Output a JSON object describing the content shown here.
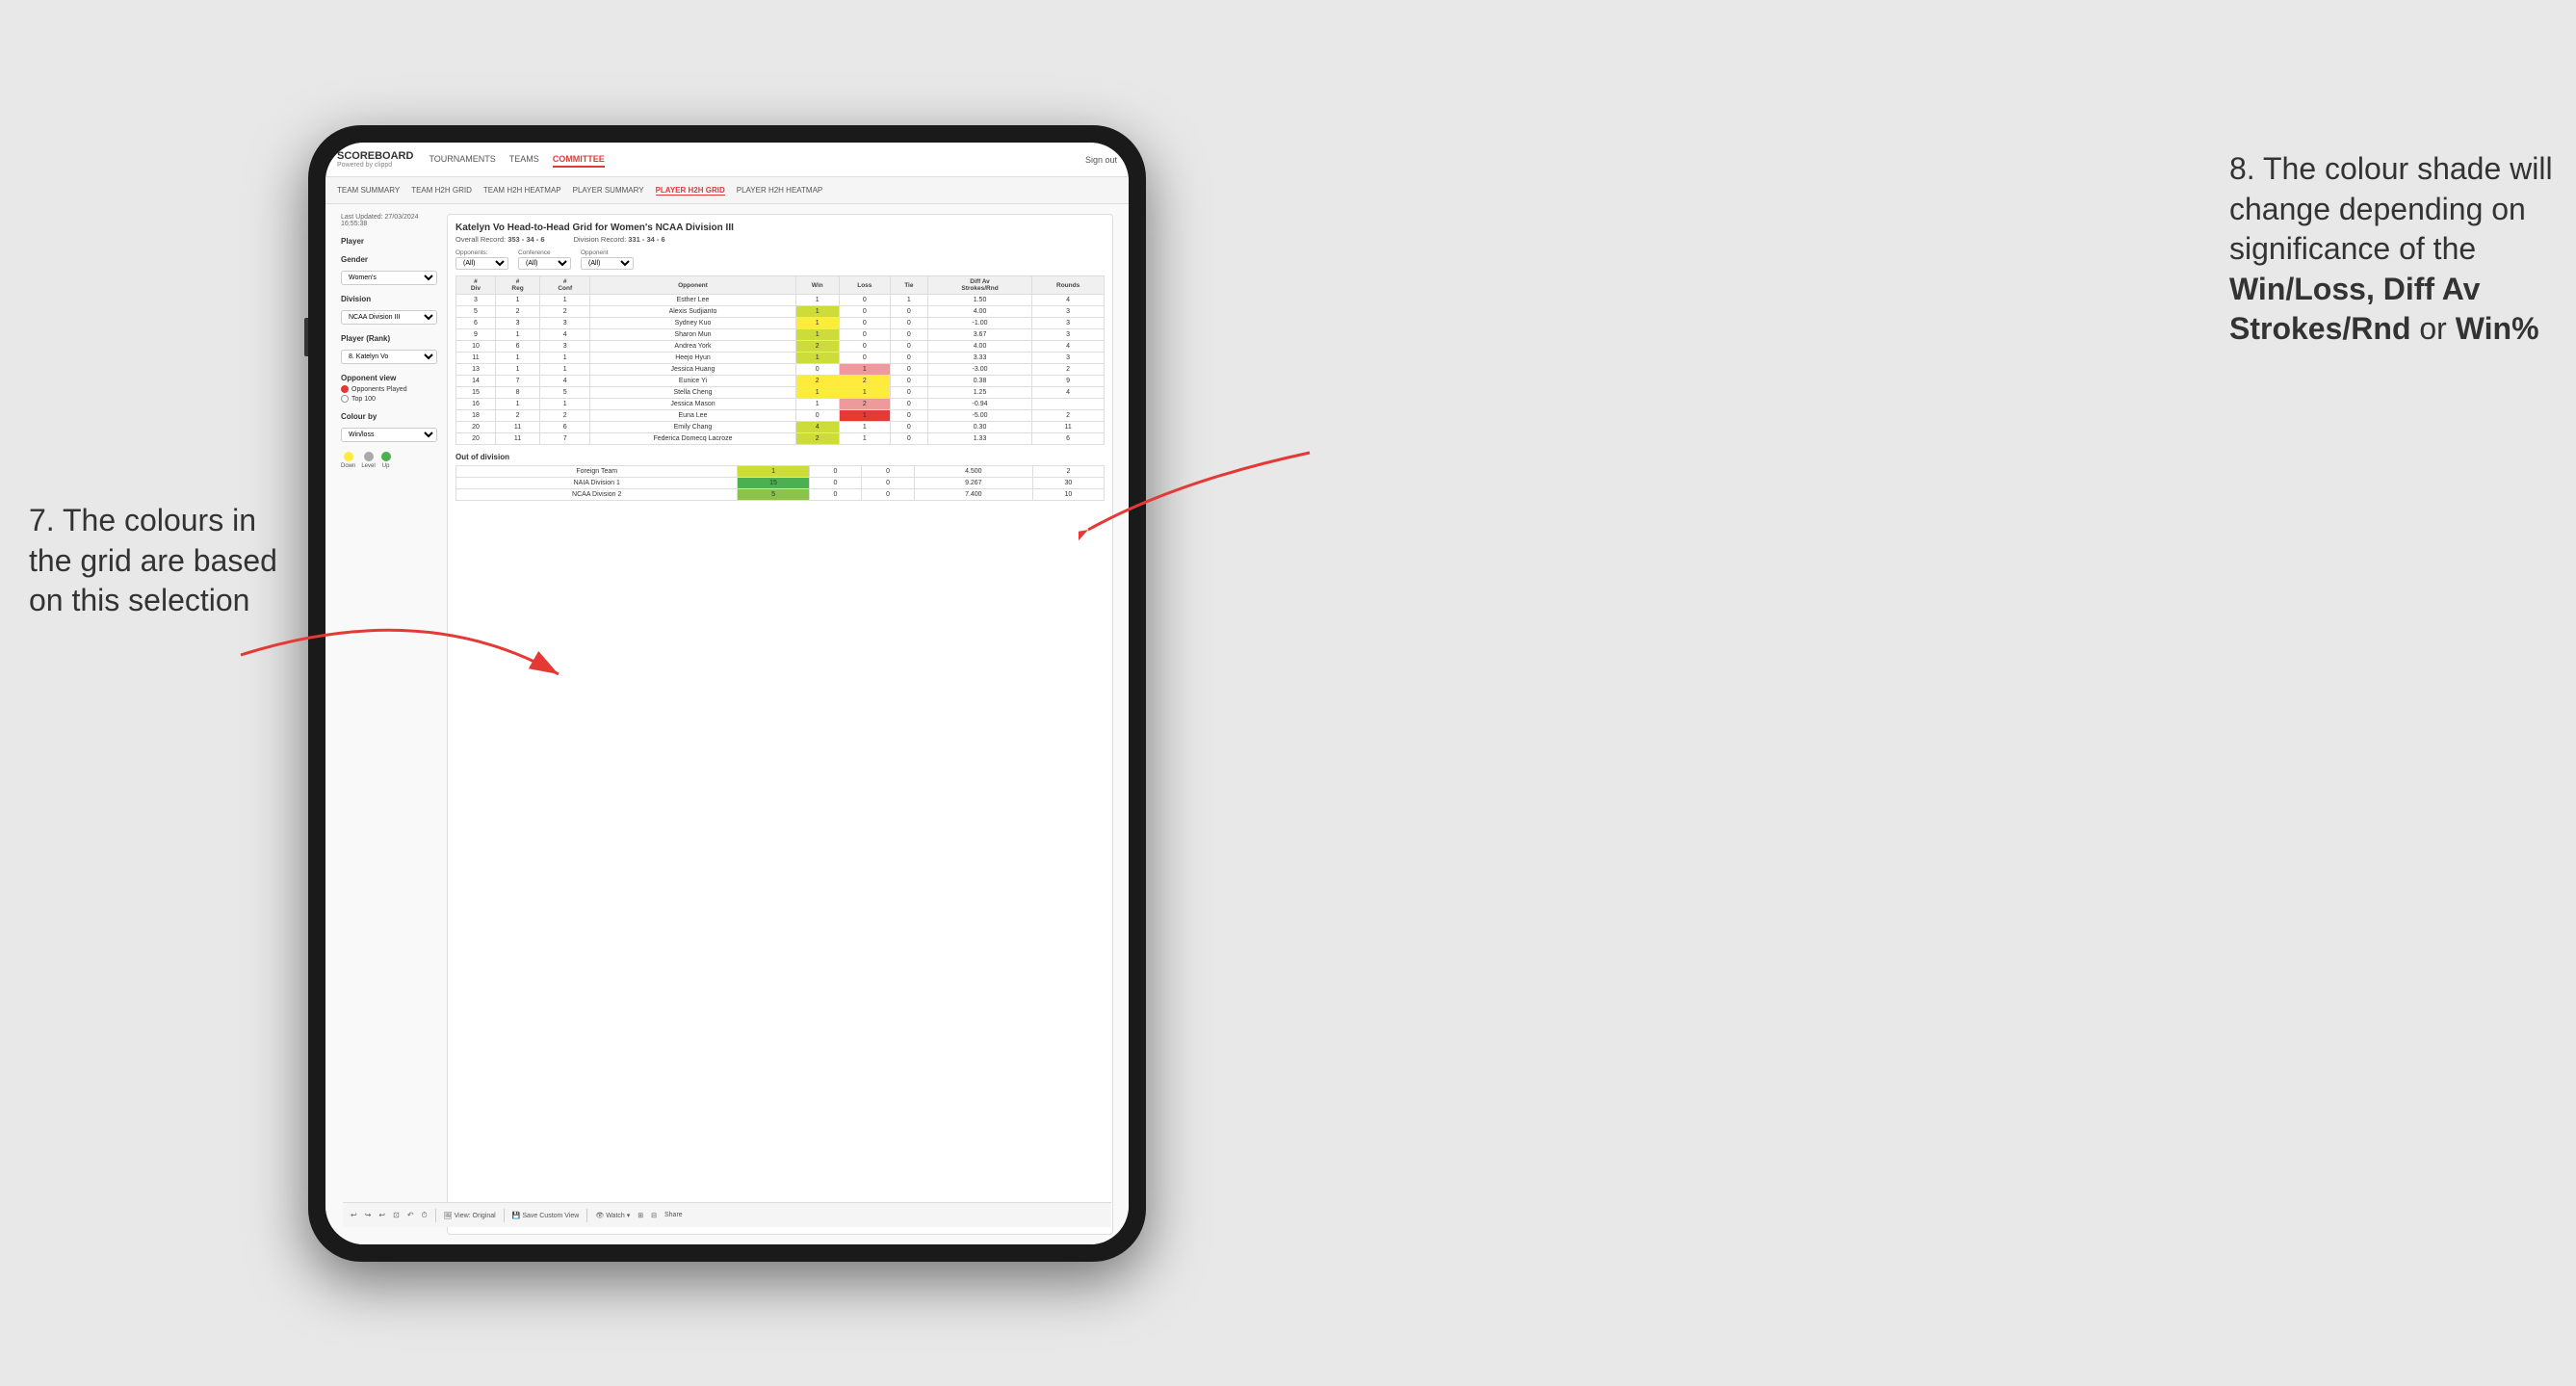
{
  "annotations": {
    "left_title": "7. The colours in the grid are based on this selection",
    "right_title_line1": "8. The colour shade will change depending on significance of the ",
    "right_bold": "Win/Loss, Diff Av Strokes/Rnd",
    "right_end": " or ",
    "right_bold2": "Win%"
  },
  "nav": {
    "logo": "SCOREBOARD",
    "logo_sub": "Powered by clippd",
    "items": [
      "TOURNAMENTS",
      "TEAMS",
      "COMMITTEE"
    ],
    "active": "COMMITTEE",
    "sign_out": "Sign out"
  },
  "sub_nav": {
    "items": [
      "TEAM SUMMARY",
      "TEAM H2H GRID",
      "TEAM H2H HEATMAP",
      "PLAYER SUMMARY",
      "PLAYER H2H GRID",
      "PLAYER H2H HEATMAP"
    ],
    "active": "PLAYER H2H GRID"
  },
  "left_panel": {
    "last_updated_label": "Last Updated: 27/03/2024",
    "last_updated_time": "16:55:38",
    "player_label": "Player",
    "gender_label": "Gender",
    "gender_value": "Women's",
    "division_label": "Division",
    "division_value": "NCAA Division III",
    "player_rank_label": "Player (Rank)",
    "player_rank_value": "8. Katelyn Vo",
    "opponent_view_label": "Opponent view",
    "opponents_played_label": "Opponents Played",
    "top100_label": "Top 100",
    "colour_by_label": "Colour by",
    "colour_by_value": "Win/loss",
    "legend": {
      "down_label": "Down",
      "level_label": "Level",
      "up_label": "Up",
      "down_color": "#ffeb3b",
      "level_color": "#aaaaaa",
      "up_color": "#4caf50"
    }
  },
  "grid": {
    "title": "Katelyn Vo Head-to-Head Grid for Women's NCAA Division III",
    "overall_record_label": "Overall Record:",
    "overall_record_value": "353 - 34 - 6",
    "division_record_label": "Division Record:",
    "division_record_value": "331 - 34 - 6",
    "filter_opponents_label": "Opponents:",
    "filter_opponents_value": "(All)",
    "filter_conference_label": "Conference",
    "filter_conference_value": "(All)",
    "filter_opponent_label": "Opponent",
    "filter_opponent_value": "(All)",
    "col_headers": [
      "#\nDiv",
      "#\nReg",
      "#\nConf",
      "Opponent",
      "Win",
      "Loss",
      "Tie",
      "Diff Av\nStrokes/Rnd",
      "Rounds"
    ],
    "rows": [
      {
        "div": "3",
        "reg": "1",
        "conf": "1",
        "opponent": "Esther Lee",
        "win": "1",
        "loss": "0",
        "tie": "1",
        "diff": "1.50",
        "rounds": "4",
        "win_class": "cell-white",
        "loss_class": "cell-white"
      },
      {
        "div": "5",
        "reg": "2",
        "conf": "2",
        "opponent": "Alexis Sudjianto",
        "win": "1",
        "loss": "0",
        "tie": "0",
        "diff": "4.00",
        "rounds": "3",
        "win_class": "cell-green-light",
        "loss_class": "cell-white"
      },
      {
        "div": "6",
        "reg": "3",
        "conf": "3",
        "opponent": "Sydney Kuo",
        "win": "1",
        "loss": "0",
        "tie": "0",
        "diff": "-1.00",
        "rounds": "3",
        "win_class": "cell-yellow",
        "loss_class": "cell-white"
      },
      {
        "div": "9",
        "reg": "1",
        "conf": "4",
        "opponent": "Sharon Mun",
        "win": "1",
        "loss": "0",
        "tie": "0",
        "diff": "3.67",
        "rounds": "3",
        "win_class": "cell-green-light",
        "loss_class": "cell-white"
      },
      {
        "div": "10",
        "reg": "6",
        "conf": "3",
        "opponent": "Andrea York",
        "win": "2",
        "loss": "0",
        "tie": "0",
        "diff": "4.00",
        "rounds": "4",
        "win_class": "cell-green-light",
        "loss_class": "cell-white"
      },
      {
        "div": "11",
        "reg": "1",
        "conf": "1",
        "opponent": "Heejo Hyun",
        "win": "1",
        "loss": "0",
        "tie": "0",
        "diff": "3.33",
        "rounds": "3",
        "win_class": "cell-green-light",
        "loss_class": "cell-white"
      },
      {
        "div": "13",
        "reg": "1",
        "conf": "1",
        "opponent": "Jessica Huang",
        "win": "0",
        "loss": "1",
        "tie": "0",
        "diff": "-3.00",
        "rounds": "2",
        "win_class": "cell-white",
        "loss_class": "cell-red-light"
      },
      {
        "div": "14",
        "reg": "7",
        "conf": "4",
        "opponent": "Eunice Yi",
        "win": "2",
        "loss": "2",
        "tie": "0",
        "diff": "0.38",
        "rounds": "9",
        "win_class": "cell-yellow",
        "loss_class": "cell-yellow"
      },
      {
        "div": "15",
        "reg": "8",
        "conf": "5",
        "opponent": "Stella Cheng",
        "win": "1",
        "loss": "1",
        "tie": "0",
        "diff": "1.25",
        "rounds": "4",
        "win_class": "cell-yellow",
        "loss_class": "cell-yellow"
      },
      {
        "div": "16",
        "reg": "1",
        "conf": "1",
        "opponent": "Jessica Mason",
        "win": "1",
        "loss": "2",
        "tie": "0",
        "diff": "-0.94",
        "rounds": "",
        "win_class": "cell-white",
        "loss_class": "cell-red-light"
      },
      {
        "div": "18",
        "reg": "2",
        "conf": "2",
        "opponent": "Euna Lee",
        "win": "0",
        "loss": "1",
        "tie": "0",
        "diff": "-5.00",
        "rounds": "2",
        "win_class": "cell-white",
        "loss_class": "cell-red-med"
      },
      {
        "div": "20",
        "reg": "11",
        "conf": "6",
        "opponent": "Emily Chang",
        "win": "4",
        "loss": "1",
        "tie": "0",
        "diff": "0.30",
        "rounds": "11",
        "win_class": "cell-green-light",
        "loss_class": "cell-white"
      },
      {
        "div": "20",
        "reg": "11",
        "conf": "7",
        "opponent": "Federica Domecq Lacroze",
        "win": "2",
        "loss": "1",
        "tie": "0",
        "diff": "1.33",
        "rounds": "6",
        "win_class": "cell-green-light",
        "loss_class": "cell-white"
      }
    ],
    "out_of_division_label": "Out of division",
    "out_of_division_rows": [
      {
        "opponent": "Foreign Team",
        "win": "1",
        "loss": "0",
        "tie": "0",
        "diff": "4.500",
        "rounds": "2",
        "win_class": "cell-green-light"
      },
      {
        "opponent": "NAIA Division 1",
        "win": "15",
        "loss": "0",
        "tie": "0",
        "diff": "9.267",
        "rounds": "30",
        "win_class": "cell-green-strong"
      },
      {
        "opponent": "NCAA Division 2",
        "win": "5",
        "loss": "0",
        "tie": "0",
        "diff": "7.400",
        "rounds": "10",
        "win_class": "cell-green-med"
      }
    ]
  },
  "toolbar": {
    "undo": "↩",
    "redo_label": "View: Original",
    "save_label": "Save Custom View",
    "watch_label": "Watch ▾",
    "share_label": "Share"
  }
}
